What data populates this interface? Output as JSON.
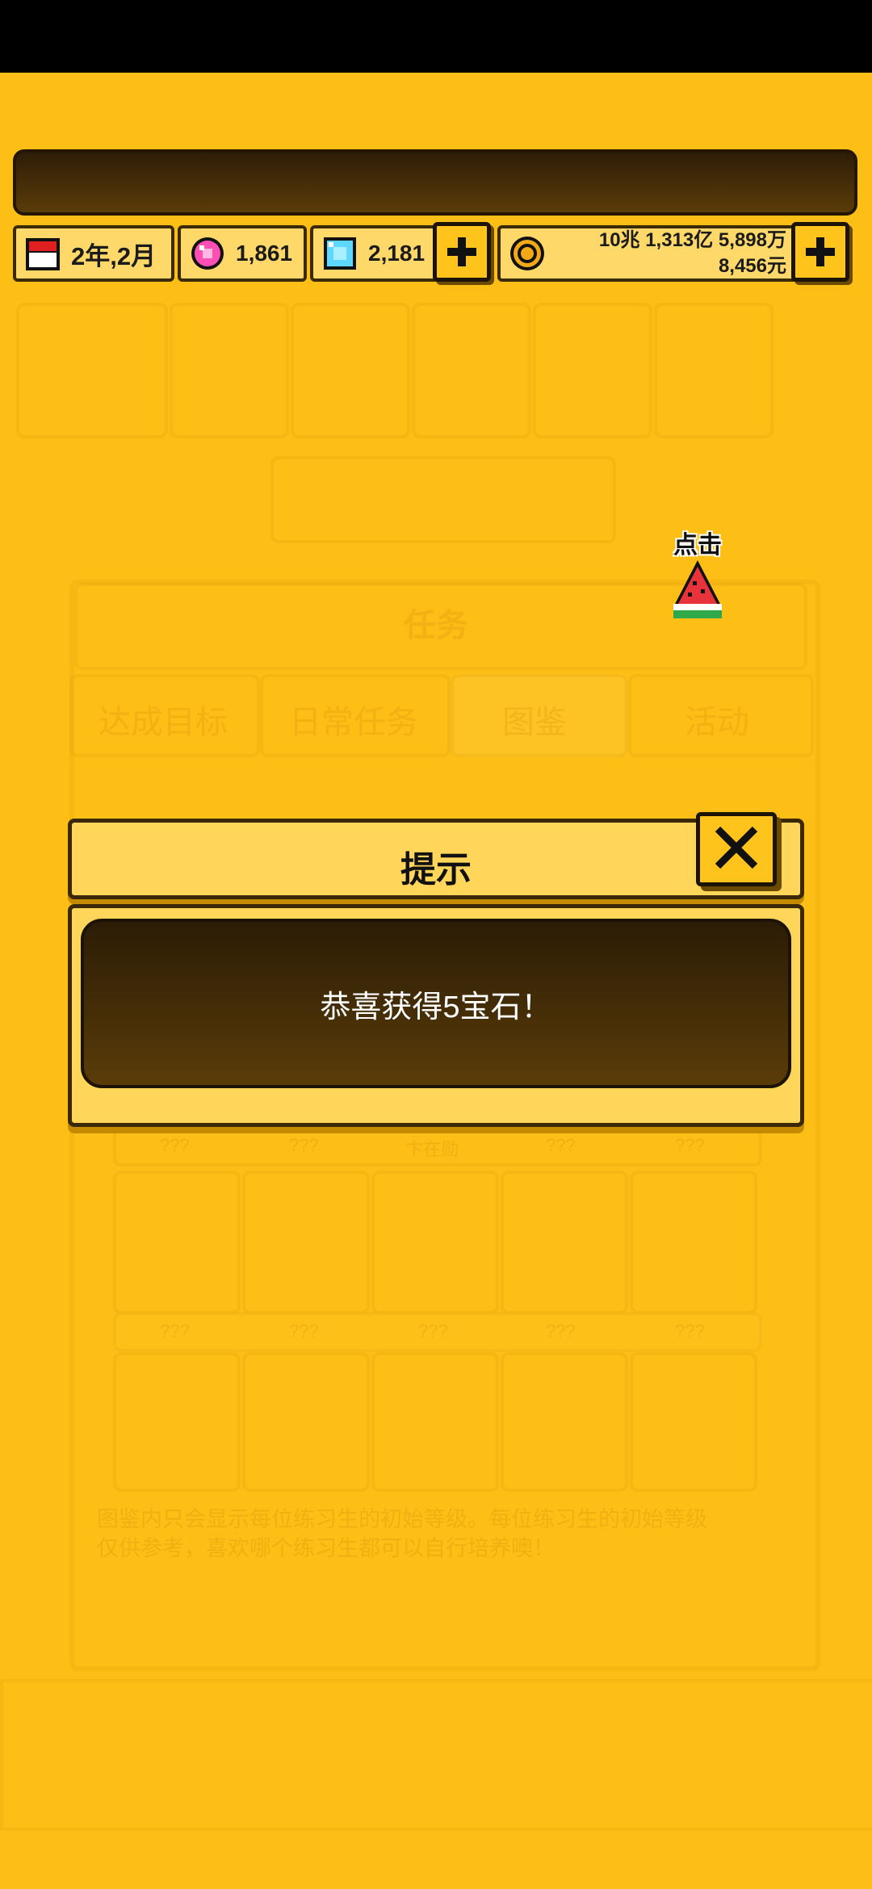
{
  "resources": {
    "date": "2年,2月",
    "pink_gems": "1,861",
    "diamonds": "2,181",
    "money_line1": "10兆 1,313亿 5,898万",
    "money_line2": "8,456元"
  },
  "icons": {
    "calendar": "calendar-icon",
    "pink_gem": "pink-gem-icon",
    "diamond": "diamond-icon",
    "coin": "coin-icon",
    "plus": "plus-icon",
    "watermelon": "watermelon-icon",
    "close": "close-icon"
  },
  "hint": {
    "label": "点击"
  },
  "background_panel": {
    "title": "任务",
    "tabs": [
      "达成目标",
      "日常任务",
      "图鉴",
      "活动"
    ],
    "card_labels_row1": [
      "???",
      "???",
      "卞在勋",
      "???",
      "???"
    ],
    "card_labels_row2": [
      "???",
      "???",
      "???",
      "???",
      "???"
    ],
    "note_line1": "图鉴内只会显示每位练习生的初始等级。每位练习生的初始等级",
    "note_line2": "仅供参考，喜欢哪个练习生都可以自行培养噢！"
  },
  "dialog": {
    "title": "提示",
    "message": "恭喜获得5宝石！"
  },
  "colors": {
    "background": "#FDBE16",
    "dialog_bg": "#FFD65A",
    "dark_panel": "#3b2706",
    "button": "#FFC41B"
  }
}
